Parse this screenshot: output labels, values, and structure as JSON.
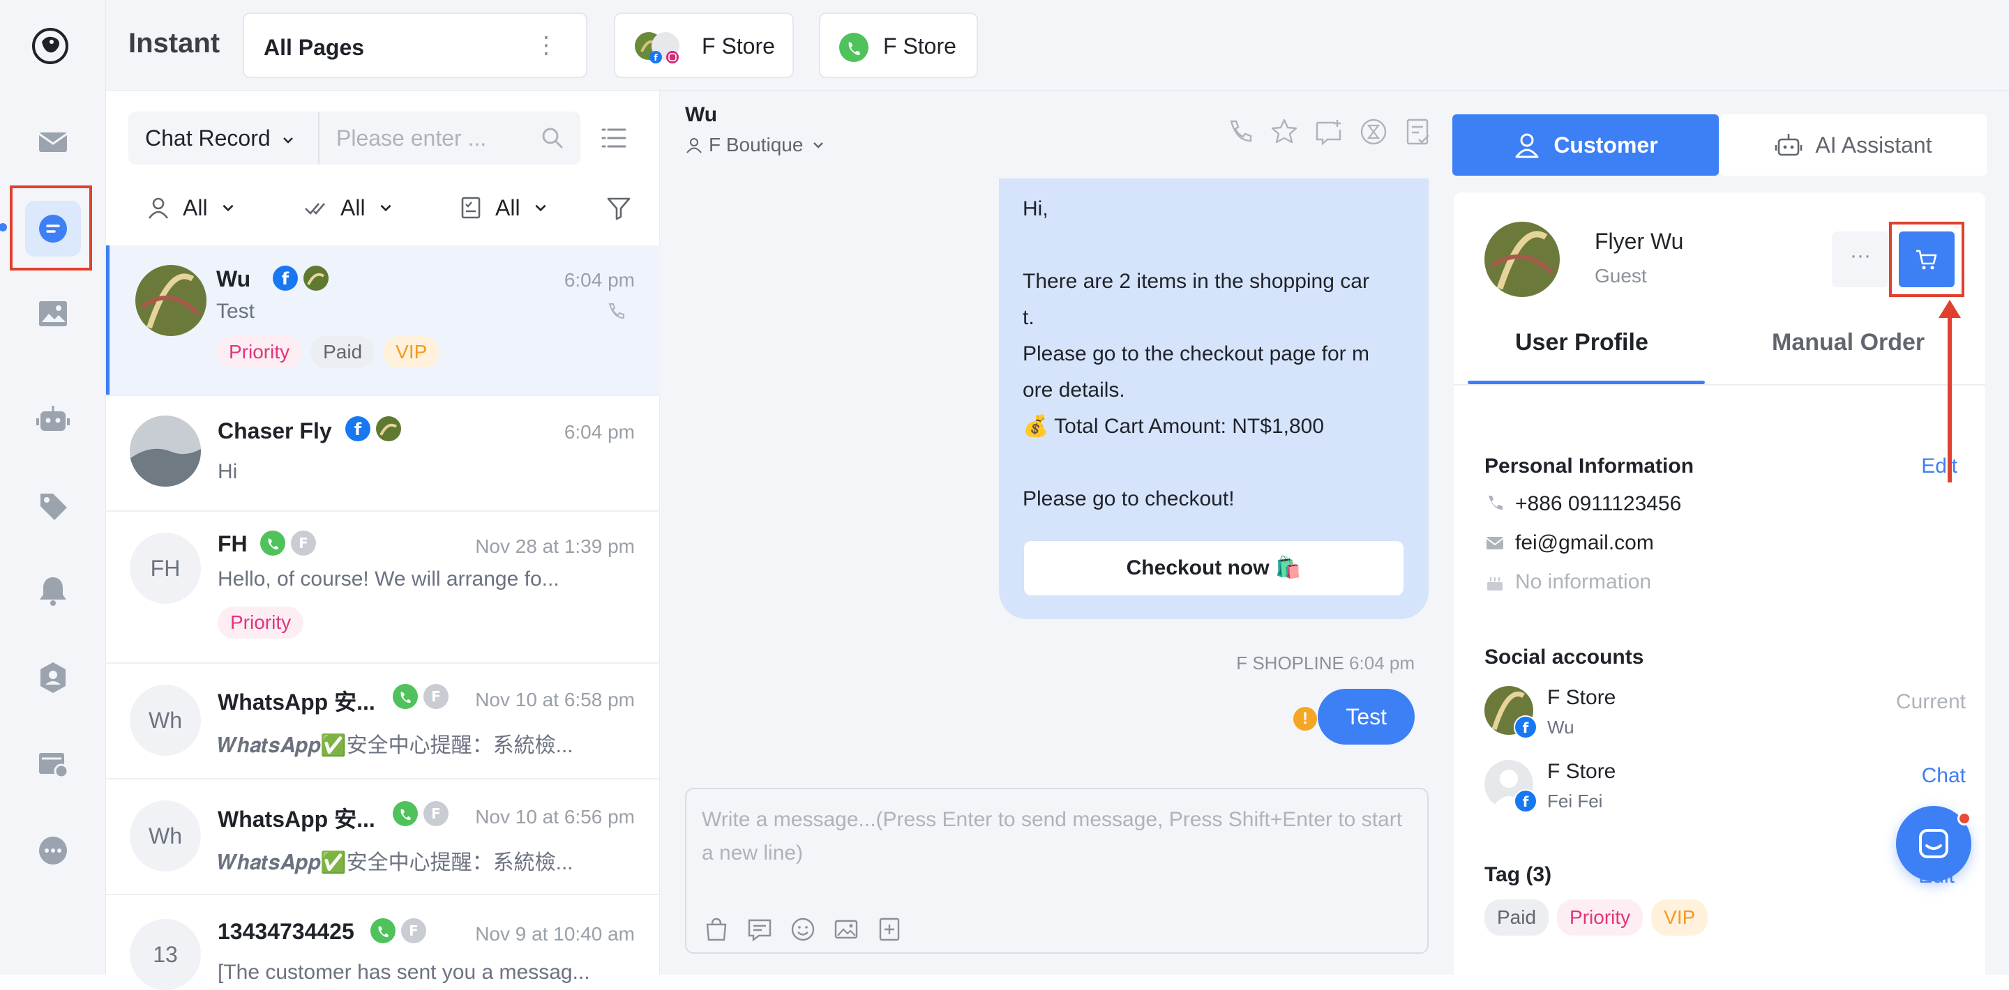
{
  "app": {
    "title": "Instant"
  },
  "topbar": {
    "page_select": "All Pages",
    "store_tabs": [
      {
        "label": "F Store",
        "icon": "facebook-instagram-avatar"
      },
      {
        "label": "F Store",
        "icon": "whatsapp-icon"
      }
    ]
  },
  "rail": {
    "items": [
      "mail-icon",
      "chat-icon",
      "gallery-icon",
      "bot-icon",
      "tag-icon",
      "bell-icon",
      "contact-icon",
      "store-settings-icon",
      "more-icon"
    ],
    "active": "chat-icon"
  },
  "chat_list": {
    "search_type": "Chat Record",
    "search_placeholder": "Please enter ...",
    "filters": [
      {
        "label": "All",
        "icon": "user-icon"
      },
      {
        "label": "All",
        "icon": "double-check-icon"
      },
      {
        "label": "All",
        "icon": "checklist-icon"
      }
    ],
    "conversations": [
      {
        "name": "Wu",
        "time": "6:04 pm",
        "snippet": "Test",
        "avatar": "",
        "tags": [
          "Priority",
          "Paid",
          "VIP"
        ]
      },
      {
        "name": "Chaser Fly",
        "time": "6:04 pm",
        "snippet": "Hi",
        "avatar": "",
        "tags": []
      },
      {
        "name": "FH",
        "time": "Nov 28 at 1:39 pm",
        "snippet": "Hello, of course! We will arrange fo...",
        "avatar": "FH",
        "tags": [
          "Priority"
        ]
      },
      {
        "name": "WhatsApp 安...",
        "time": "Nov 10 at 6:58 pm",
        "snippet": "𝑾𝒉𝒂𝒕𝒔𝑨𝒑𝒑✅安全中心提醒：系統檢...",
        "avatar": "Wh",
        "tags": []
      },
      {
        "name": "WhatsApp 安...",
        "time": "Nov 10 at 6:56 pm",
        "snippet": "𝑾𝒉𝒂𝒕𝒔𝑨𝒑𝒑✅安全中心提醒：系統檢...",
        "avatar": "Wh",
        "tags": []
      },
      {
        "name": "13434734425",
        "time": "Nov 9 at 10:40 am",
        "snippet": "[The customer has sent you a messag...",
        "avatar": "13",
        "tags": []
      }
    ]
  },
  "chat": {
    "name": "Wu",
    "boutique": "F Boutique",
    "incoming_lines": [
      "Hi,",
      "",
      "There are 2 items in the shopping car",
      "t.",
      "Please go to the checkout page for m",
      "ore details.",
      "💰 Total Cart Amount: NT$1,800",
      "",
      "Please go to checkout!"
    ],
    "checkout_label": "Checkout now 🛍️",
    "sender": "F SHOPLINE",
    "sender_time": "6:04 pm",
    "outgoing": "Test",
    "warning": "!",
    "composer_placeholder": "Write a message...(Press Enter to send message, Press Shift+Enter to start a new line)"
  },
  "panel": {
    "tab_customer": "Customer",
    "tab_ai": "AI Assistant",
    "profile_name": "Flyer Wu",
    "profile_role": "Guest",
    "more_label": "···",
    "tab_user_profile": "User Profile",
    "tab_manual_order": "Manual Order",
    "personal_title": "Personal Information",
    "edit_label": "Edit",
    "phone": "+886 0911123456",
    "email": "fei@gmail.com",
    "birthday": "No information",
    "social_title": "Social accounts",
    "social_accounts": [
      {
        "name": "F Store",
        "sub": "Wu",
        "action": "Current"
      },
      {
        "name": "F Store",
        "sub": "Fei Fei",
        "action": "Chat"
      }
    ],
    "tag_title": "Tag (3)",
    "tags": [
      "Paid",
      "Priority",
      "VIP"
    ],
    "tag_edit": "Edit"
  },
  "colors": {
    "accent": "#3d7ff5",
    "highlight": "#e0412f",
    "priority": "#e2357b",
    "vip": "#f39b1f"
  }
}
